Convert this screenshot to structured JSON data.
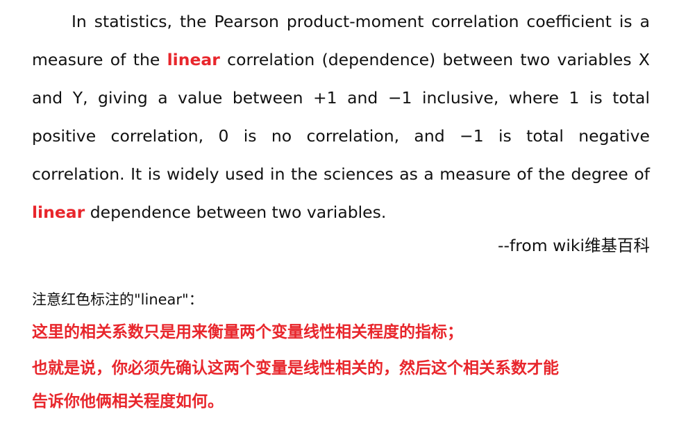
{
  "quote": {
    "part1": "In statistics, the Pearson product-moment correlation coefficient is a measure of the ",
    "highlight1": "linear",
    "part2": " correlation (dependence) between two variables X and Y, giving a value between +1 and −1 inclusive, where 1 is total positive correlation, 0 is no correlation, and −1 is total negative correlation. It is widely used in the sciences as a measure of the degree of ",
    "highlight2": "linear",
    "part3": " dependence between two variables.",
    "source": "--from wiki维基百科"
  },
  "note": {
    "intro": "注意红色标注的\"linear\"：",
    "red_line_1": "这里的相关系数只是用来衡量两个变量线性相关程度的指标；",
    "red_line_2": "也就是说，你必须先确认这两个变量是线性相关的，然后这个相关系数才能",
    "red_line_3": "告诉你他俩相关程度如何。"
  },
  "colors": {
    "highlight": "#e8262c",
    "text": "#111111",
    "background": "#ffffff"
  }
}
